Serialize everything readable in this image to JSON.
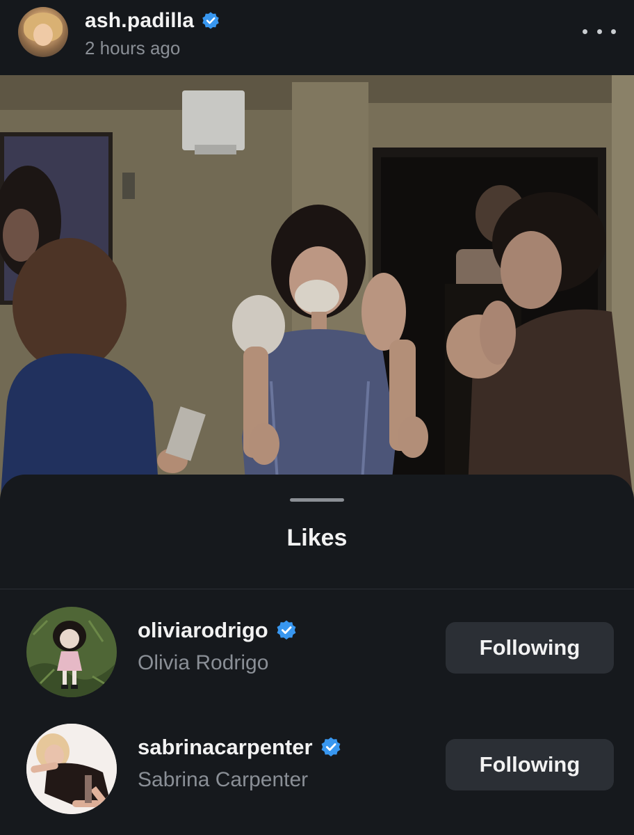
{
  "post": {
    "author_username": "ash.padilla",
    "author_verified": true,
    "timestamp": "2 hours ago",
    "more_icon": "more-horizontal-icon"
  },
  "likes_sheet": {
    "title": "Likes",
    "users": [
      {
        "username": "oliviarodrigo",
        "full_name": "Olivia Rodrigo",
        "verified": true,
        "button_label": "Following"
      },
      {
        "username": "sabrinacarpenter",
        "full_name": "Sabrina Carpenter",
        "verified": true,
        "button_label": "Following"
      }
    ]
  },
  "colors": {
    "background": "#15181c",
    "verified_badge": "#3897f0",
    "button_bg": "#2b2f35",
    "secondary_text": "#8a8f96"
  }
}
